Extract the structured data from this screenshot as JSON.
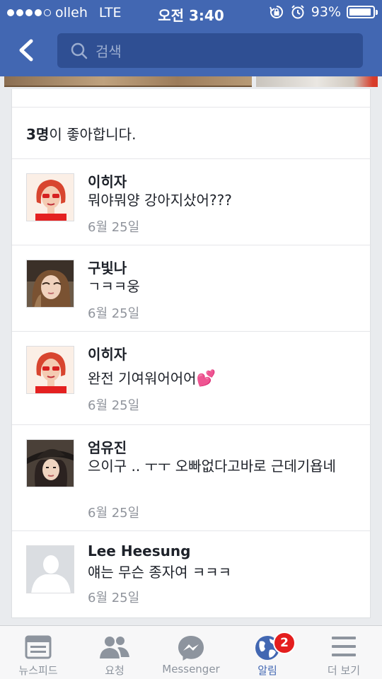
{
  "status_bar": {
    "carrier": "olleh",
    "network": "LTE",
    "time": "오전 3:40",
    "battery_percent": "93%",
    "battery_level": 0.93,
    "signal_bars_filled": 4,
    "signal_bars_total": 5
  },
  "header": {
    "search_placeholder": "검색",
    "color": "#4267b2"
  },
  "likes": {
    "count": "3명",
    "suffix": "이 좋아합니다."
  },
  "comments": [
    {
      "name": "이히자",
      "text": "뭐야뭐양 강아지샀어???",
      "date": "6월 25일",
      "avatar": "red-hair-woman"
    },
    {
      "name": "구빛나",
      "text": "ㄱㅋㅋ웅",
      "date": "6월 25일",
      "avatar": "woman-photo"
    },
    {
      "name": "이히자",
      "text": "완전 기여워어어어",
      "emoji": "💕",
      "date": "6월 25일",
      "avatar": "red-hair-woman"
    },
    {
      "name": "엄유진",
      "text": "으이구 .. ㅜㅜ 오빠없다고바로 근데기욥네",
      "date": "6월 25일",
      "avatar": "woman-hat-photo"
    },
    {
      "name": "Lee Heesung",
      "text": "얘는 무슨 종자여 ㅋㅋㅋ",
      "date": "6월 25일",
      "avatar": "default-silhouette"
    }
  ],
  "tabbar": {
    "tabs": [
      {
        "label": "뉴스피드",
        "icon": "news-feed-icon"
      },
      {
        "label": "요청",
        "icon": "friend-requests-icon"
      },
      {
        "label": "Messenger",
        "icon": "messenger-icon"
      },
      {
        "label": "알림",
        "icon": "globe-icon",
        "badge": "2",
        "active": true
      },
      {
        "label": "더 보기",
        "icon": "menu-icon"
      }
    ]
  }
}
